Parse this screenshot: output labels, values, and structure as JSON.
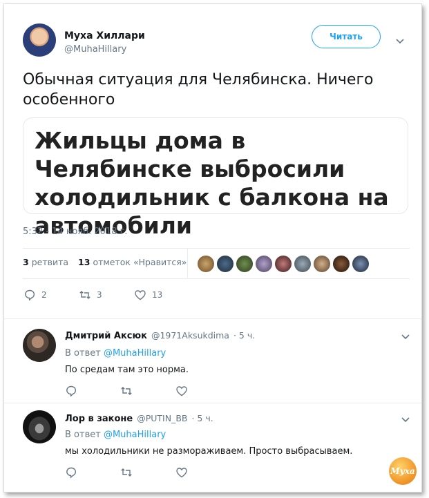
{
  "tweet": {
    "author_name": "Муха Хиллари",
    "author_handle": "@MuhaHillary",
    "follow_label": "Читать",
    "text": "Обычная ситуация для Челябинска. Ничего особенного",
    "quote_headline": "Жильцы дома в Челябинске выбросили холодильник с балкона на автомобили",
    "timestamp": "5:32 - 14 нояб. 2018 г.",
    "retweets_count": "3",
    "retweets_label": "ретвита",
    "likes_count": "13",
    "likes_label": "отметок «Нравится»",
    "reply_count": "2",
    "retweet_action_count": "3",
    "like_action_count": "13"
  },
  "replies": [
    {
      "name": "Дмитрий Аксюк",
      "handle": "@1971Aksukdima",
      "time": "· 5 ч.",
      "reply_prefix": "В ответ",
      "reply_to": "@MuhaHillary",
      "text": "По средам там это норма."
    },
    {
      "name": "Лор в законе",
      "handle": "@PUTIN_BB",
      "time": "· 5 ч.",
      "reply_prefix": "В ответ",
      "reply_to": "@MuhaHillary",
      "text": "мы холодильники не размораживаем. Просто выбрасываем."
    }
  ],
  "watermark": "Муха",
  "colors": {
    "accent": "#1da1f2",
    "muted": "#657786",
    "text": "#14171a",
    "border": "#e6ecf0"
  },
  "icons": [
    "reply-icon",
    "retweet-icon",
    "like-icon",
    "chevron-down-icon"
  ]
}
